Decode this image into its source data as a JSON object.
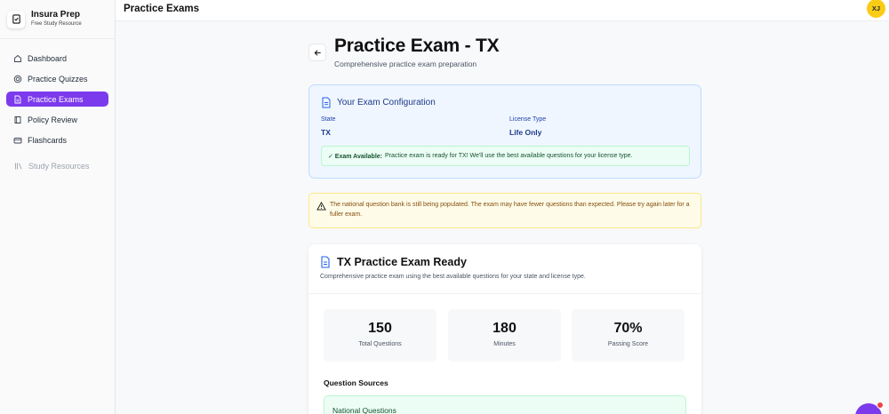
{
  "brand": {
    "name": "Insura Prep",
    "tagline": "Free Study Resource"
  },
  "nav": {
    "items": [
      {
        "label": "Dashboard",
        "icon": "home-icon"
      },
      {
        "label": "Practice Quizzes",
        "icon": "target-icon"
      },
      {
        "label": "Practice Exams",
        "icon": "document-icon",
        "active": true
      },
      {
        "label": "Policy Review",
        "icon": "book-icon"
      },
      {
        "label": "Flashcards",
        "icon": "cards-icon"
      }
    ],
    "secondary": {
      "label": "Study Resources",
      "icon": "library-icon"
    }
  },
  "topbar": {
    "title": "Practice Exams",
    "avatar_initials": "XJ"
  },
  "page": {
    "title": "Practice Exam - TX",
    "subtitle": "Comprehensive practice exam preparation"
  },
  "config": {
    "heading": "Your Exam Configuration",
    "state_label": "State",
    "state_value": "TX",
    "license_label": "License Type",
    "license_value": "Life Only",
    "available_prefix": "✓ Exam Available:",
    "available_text": "Practice exam is ready for TX! We'll use the best available questions for your license type."
  },
  "warning": {
    "text": "The national question bank is still being populated. The exam may have fewer questions than expected. Please try again later for a fuller exam."
  },
  "ready": {
    "heading": "TX Practice Exam Ready",
    "description": "Comprehensive practice exam using the best available questions for your state and license type.",
    "stats": [
      {
        "value": "150",
        "label": "Total Questions"
      },
      {
        "value": "180",
        "label": "Minutes"
      },
      {
        "value": "70%",
        "label": "Passing Score"
      }
    ],
    "sources_heading": "Question Sources",
    "sources": [
      {
        "label": "National Questions"
      }
    ]
  },
  "colors": {
    "accent": "#7c3aed",
    "avatar": "#facc15",
    "info_bg": "#eff6ff",
    "warn_bg": "#fefce8",
    "success_bg": "#ecfdf5"
  }
}
